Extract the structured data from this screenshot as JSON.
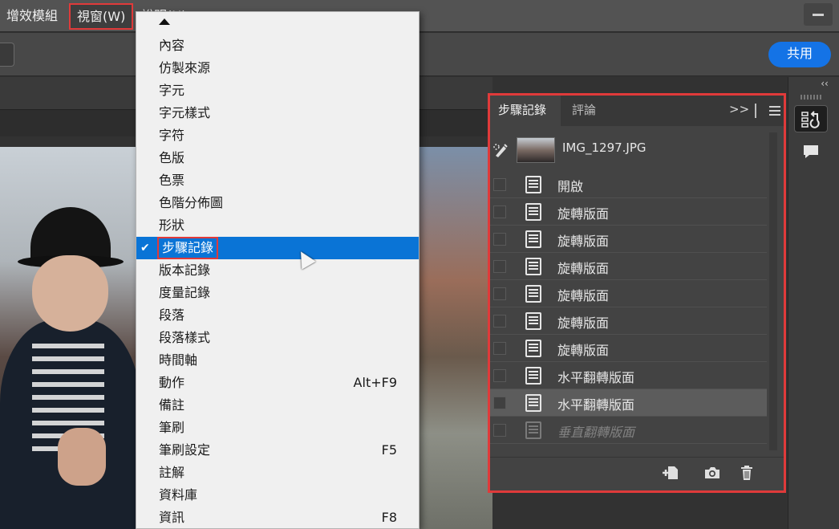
{
  "menubar": {
    "plugins": "增效模組",
    "window": "視窗(W)",
    "help": "說明(H)"
  },
  "toolbar": {
    "share_label": "共用"
  },
  "window_menu": {
    "items": [
      {
        "label": "內容",
        "shortcut": ""
      },
      {
        "label": "仿製來源",
        "shortcut": ""
      },
      {
        "label": "字元",
        "shortcut": ""
      },
      {
        "label": "字元樣式",
        "shortcut": ""
      },
      {
        "label": "字符",
        "shortcut": ""
      },
      {
        "label": "色版",
        "shortcut": ""
      },
      {
        "label": "色票",
        "shortcut": ""
      },
      {
        "label": "色階分佈圖",
        "shortcut": ""
      },
      {
        "label": "形狀",
        "shortcut": ""
      },
      {
        "label": "步驟記錄",
        "shortcut": "",
        "checked": true
      },
      {
        "label": "版本記錄",
        "shortcut": ""
      },
      {
        "label": "度量記錄",
        "shortcut": ""
      },
      {
        "label": "段落",
        "shortcut": ""
      },
      {
        "label": "段落樣式",
        "shortcut": ""
      },
      {
        "label": "時間軸",
        "shortcut": ""
      },
      {
        "label": "動作",
        "shortcut": "Alt+F9"
      },
      {
        "label": "備註",
        "shortcut": ""
      },
      {
        "label": "筆刷",
        "shortcut": ""
      },
      {
        "label": "筆刷設定",
        "shortcut": "F5"
      },
      {
        "label": "註解",
        "shortcut": ""
      },
      {
        "label": "資料庫",
        "shortcut": ""
      },
      {
        "label": "資訊",
        "shortcut": "F8"
      }
    ]
  },
  "history_panel": {
    "tab_history": "步驟記錄",
    "tab_comments": "評論",
    "more": ">>",
    "snapshot": "IMG_1297.JPG",
    "steps": [
      {
        "label": "開啟",
        "state": "normal"
      },
      {
        "label": "旋轉版面",
        "state": "normal"
      },
      {
        "label": "旋轉版面",
        "state": "normal"
      },
      {
        "label": "旋轉版面",
        "state": "normal"
      },
      {
        "label": "旋轉版面",
        "state": "normal"
      },
      {
        "label": "旋轉版面",
        "state": "normal"
      },
      {
        "label": "旋轉版面",
        "state": "normal"
      },
      {
        "label": "水平翻轉版面",
        "state": "normal"
      },
      {
        "label": "水平翻轉版面",
        "state": "selected"
      },
      {
        "label": "垂直翻轉版面",
        "state": "future"
      }
    ]
  },
  "dock": {
    "collapse": "‹‹"
  },
  "icons": {
    "history_brush": "history-brush-icon",
    "new_document": "new-document-icon",
    "snapshot": "camera-icon",
    "delete": "trash-icon",
    "history": "history-panel-icon",
    "comment": "comment-icon"
  },
  "colors": {
    "accent": "#1473e6",
    "highlight": "#0a74d6",
    "annotation": "#e03a3a"
  }
}
